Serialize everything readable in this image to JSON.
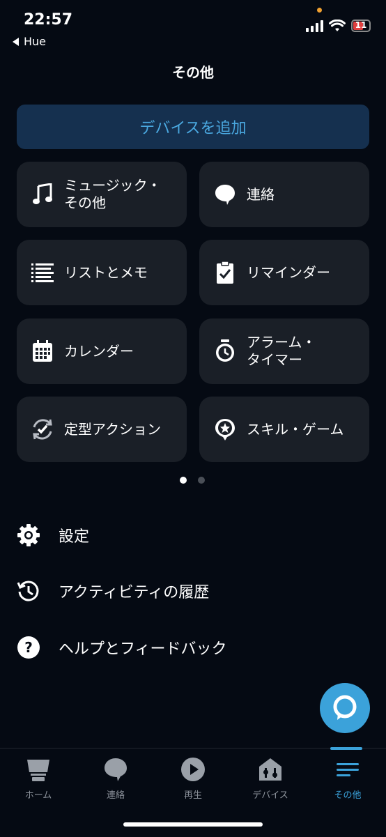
{
  "status": {
    "time": "22:57",
    "back_label": "Hue",
    "battery": "11"
  },
  "header": {
    "title": "その他"
  },
  "add_device": {
    "label": "デバイスを追加"
  },
  "tiles": [
    {
      "label": "ミュージック・\nその他",
      "icon": "music-note-icon"
    },
    {
      "label": "連絡",
      "icon": "chat-bubble-icon"
    },
    {
      "label": "リストとメモ",
      "icon": "list-icon"
    },
    {
      "label": "リマインダー",
      "icon": "clipboard-check-icon"
    },
    {
      "label": "カレンダー",
      "icon": "calendar-icon"
    },
    {
      "label": "アラーム・\nタイマー",
      "icon": "alarm-clock-icon"
    },
    {
      "label": "定型アクション",
      "icon": "routine-check-icon"
    },
    {
      "label": "スキル・ゲーム",
      "icon": "skill-star-icon"
    }
  ],
  "pager": {
    "pages": 2,
    "current": 1
  },
  "menu": [
    {
      "label": "設定",
      "icon": "gear-icon"
    },
    {
      "label": "アクティビティの履歴",
      "icon": "history-icon"
    },
    {
      "label": "ヘルプとフィードバック",
      "icon": "help-icon"
    }
  ],
  "tabs": [
    {
      "label": "ホーム",
      "icon": "home-icon"
    },
    {
      "label": "連絡",
      "icon": "chat-bubble-icon"
    },
    {
      "label": "再生",
      "icon": "play-icon"
    },
    {
      "label": "デバイス",
      "icon": "devices-icon"
    },
    {
      "label": "その他",
      "icon": "menu-icon",
      "active": true
    }
  ],
  "colors": {
    "background": "#050a13",
    "tile": "#1a1f27",
    "accent": "#3ba2da",
    "add_device_bg": "#15304f",
    "battery_low": "#e04040"
  }
}
